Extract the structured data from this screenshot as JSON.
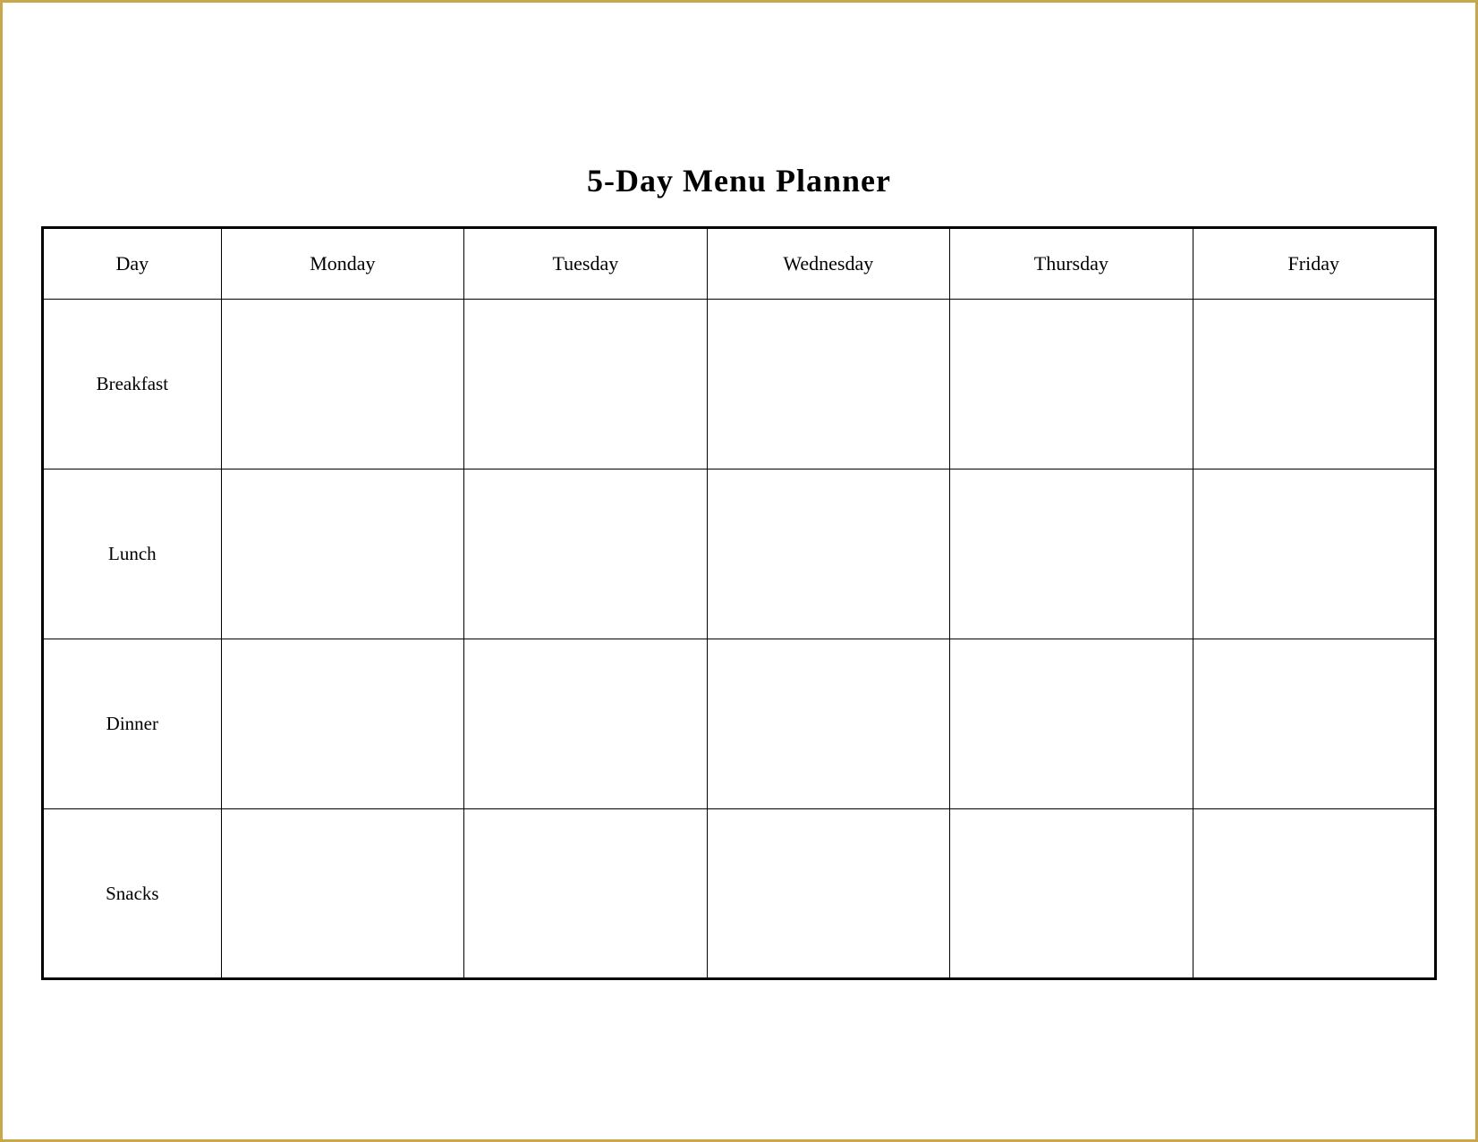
{
  "title": "5-Day Menu Planner",
  "columns": {
    "day": "Day",
    "monday": "Monday",
    "tuesday": "Tuesday",
    "wednesday": "Wednesday",
    "thursday": "Thursday",
    "friday": "Friday"
  },
  "rows": [
    {
      "label": "Breakfast"
    },
    {
      "label": "Lunch"
    },
    {
      "label": "Dinner"
    },
    {
      "label": "Snacks"
    }
  ]
}
